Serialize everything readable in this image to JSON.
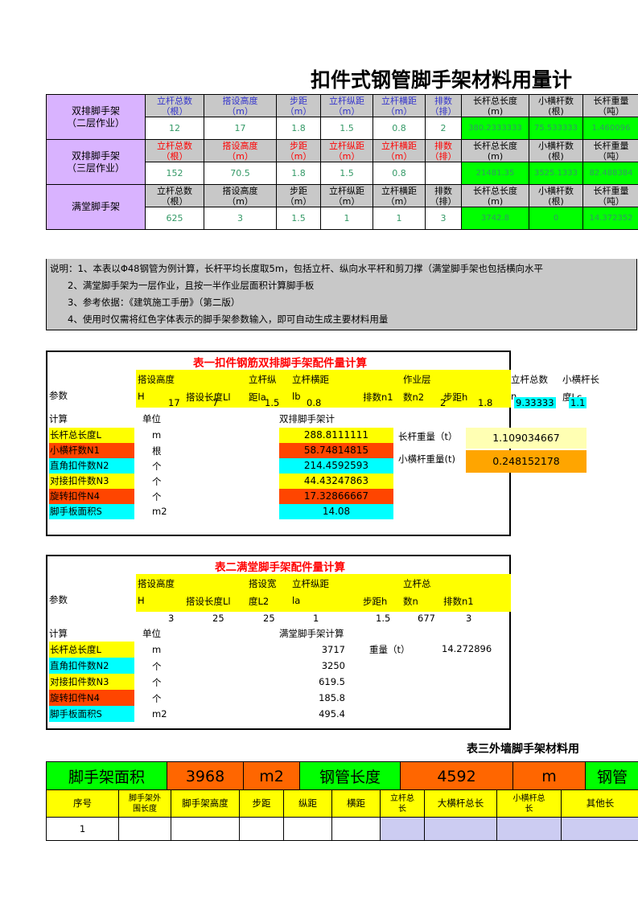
{
  "document": {
    "title": "扣件式钢管脚手架材料用量计"
  },
  "table_a": {
    "columns": [
      "立杆总数（根）",
      "搭设高度（m）",
      "步距（m）",
      "立杆纵距（m）",
      "立杆横距（m）",
      "排数（排）",
      "长杆总长度（m）",
      "小横杆数（根）",
      "长杆重量（吨）"
    ],
    "col_lines": [
      {
        "l1": "立杆总数",
        "l2": "（根）"
      },
      {
        "l1": "搭设高度",
        "l2": "（m）"
      },
      {
        "l1": "步距",
        "l2": "（m）"
      },
      {
        "l1": "立杆纵距",
        "l2": "（m）"
      },
      {
        "l1": "立杆横距",
        "l2": "（m）"
      },
      {
        "l1": "排数",
        "l2": "（排）"
      },
      {
        "l1": "长杆总长度",
        "l2": "(m)"
      },
      {
        "l1": "小横杆数",
        "l2": "(根)"
      },
      {
        "l1": "长杆重量",
        "l2": "（吨）"
      }
    ],
    "rows": [
      {
        "label_l1": "双排脚手架",
        "label_l2": "（二层作业）",
        "header_color": "#3333cc",
        "values": [
          "12",
          "17",
          "1.8",
          "1.5",
          "0.8",
          "2",
          "380.2333333",
          "75.533333",
          "1.460096"
        ]
      },
      {
        "label_l1": "双排脚手架",
        "label_l2": "（三层作业）",
        "header_color": "#ff0000",
        "values": [
          "152",
          "70.5",
          "1.8",
          "1.5",
          "0.8",
          "",
          "21481.35",
          "3525.1333",
          "82.488384"
        ]
      },
      {
        "label_l1": "满堂脚手架",
        "label_l2": "",
        "header_color": "#000000",
        "values": [
          "625",
          "3",
          "1.5",
          "1",
          "1",
          "3",
          "3742.8",
          "0",
          "14.372352"
        ]
      }
    ]
  },
  "notes": {
    "line1": "说明：1、本表以Φ48钢管为例计算，长杆平均长度取5m，包括立杆、纵向水平杆和剪刀撑（满堂脚手架也包括横向水平",
    "line2": "2、满堂脚手架为一层作业，且按一半作业层面积计算脚手板",
    "line3": "3、参考依据：《建筑施工手册》（第二版）",
    "line4": "4、使用时仅需将红色字体表示的脚手架参数输入，即可自动生成主要材料用量"
  },
  "table1": {
    "title": "表一扣件钢筋双排脚手架配件量计算",
    "param_label": "参数",
    "headers": [
      {
        "l1": "搭设高度",
        "l2": "H"
      },
      {
        "l1": "",
        "l2": "搭设长度Ll"
      },
      {
        "l1": "立杆纵",
        "l2": "距la"
      },
      {
        "l1": "立杆横距",
        "l2": "lb"
      },
      {
        "l1": "",
        "l2": "排数n1"
      },
      {
        "l1": "作业层",
        "l2": "数n2"
      },
      {
        "l1": "",
        "l2": "步距h"
      },
      {
        "l1": "立杆总数",
        "l2": "n"
      },
      {
        "l1": "小横杆长",
        "l2": "度Lc"
      }
    ],
    "param_values": [
      "17",
      "7",
      "1.5",
      "0.8",
      "",
      "2",
      "1.8",
      "9.33333",
      "1.1"
    ],
    "calc_label": "计算",
    "unit_label": "单位",
    "result_label": "双排脚手架计",
    "rows": [
      {
        "label": "长杆总长度L",
        "unit": "m",
        "value": "288.8111111",
        "label_bg": "#ffff00",
        "value_bg": "#ffff00"
      },
      {
        "label": "小横杆数N1",
        "unit": "根",
        "value": "58.74814815",
        "label_bg": "#ff4500",
        "value_bg": "#ff4500"
      },
      {
        "label": "直角扣件数N2",
        "unit": "个",
        "value": "214.4592593",
        "label_bg": "#00ffff",
        "value_bg": "#00ffff"
      },
      {
        "label": "对接扣件数N3",
        "unit": "个",
        "value": "44.43247863",
        "label_bg": "#ffff00",
        "value_bg": "#ffff00"
      },
      {
        "label": "旋转扣件N4",
        "unit": "个",
        "value": "17.32866667",
        "label_bg": "#ff4500",
        "value_bg": "#ff4500"
      },
      {
        "label": "脚手板面积S",
        "unit": "m2",
        "value": "14.08",
        "label_bg": "#00ffff",
        "value_bg": "#00ffff"
      }
    ],
    "weights": [
      {
        "label": "长杆重量（t）",
        "value": "1.109034667",
        "bg": "#ffffb3"
      },
      {
        "label": "小横杆重量(t)",
        "value": "0.248152178",
        "bg": "#ffa500"
      }
    ]
  },
  "table2": {
    "title": "表二满堂脚手架配件量计算",
    "param_label": "参数",
    "headers": [
      {
        "l1": "搭设高度",
        "l2": "H"
      },
      {
        "l1": "",
        "l2": "搭设长度Ll"
      },
      {
        "l1": "搭设宽",
        "l2": "度L2"
      },
      {
        "l1": "立杆纵距",
        "l2": "la"
      },
      {
        "l1": "",
        "l2": "步距h"
      },
      {
        "l1": "立杆总",
        "l2": "数n"
      },
      {
        "l1": "",
        "l2": "排数n1"
      }
    ],
    "param_values": [
      "3",
      "25",
      "25",
      "1",
      "1.5",
      "677",
      "3"
    ],
    "calc_label": "计算",
    "unit_label": "单位",
    "result_label": "满堂脚手架计算",
    "rows": [
      {
        "label": "长杆总长度L",
        "unit": "m",
        "value": "3717",
        "label_bg": "#ffff00"
      },
      {
        "label": "直角扣件数N2",
        "unit": "个",
        "value": "3250",
        "label_bg": "#00ffff"
      },
      {
        "label": "对接扣件数N3",
        "unit": "个",
        "value": "619.5",
        "label_bg": "#ffff00"
      },
      {
        "label": "旋转扣件N4",
        "unit": "个",
        "value": "185.8",
        "label_bg": "#ff4500"
      },
      {
        "label": "脚手板面积S",
        "unit": "m2",
        "value": "495.4",
        "label_bg": "#00ffff"
      }
    ],
    "weight_label": "重量（t）",
    "weight_value": "14.272896"
  },
  "table3": {
    "caption": "表三外墙脚手架材料用",
    "banner": [
      {
        "text": "脚手架面积",
        "kind": "label"
      },
      {
        "text": "3968",
        "kind": "value"
      },
      {
        "text": "m2",
        "kind": "unit"
      },
      {
        "text": "钢管长度",
        "kind": "label"
      },
      {
        "text": "4592",
        "kind": "value"
      },
      {
        "text": "m",
        "kind": "unit"
      },
      {
        "text": "钢管",
        "kind": "label"
      }
    ],
    "columns": [
      {
        "l1": "序号",
        "l2": ""
      },
      {
        "l1": "脚手架外",
        "l2": "围长度"
      },
      {
        "l1": "脚手架高度",
        "l2": ""
      },
      {
        "l1": "步距",
        "l2": ""
      },
      {
        "l1": "纵距",
        "l2": ""
      },
      {
        "l1": "横距",
        "l2": ""
      },
      {
        "l1": "立杆总",
        "l2": "长"
      },
      {
        "l1": "大横杆总长",
        "l2": ""
      },
      {
        "l1": "小横杆总",
        "l2": "长"
      },
      {
        "l1": "其他长",
        "l2": ""
      }
    ],
    "row": [
      "1",
      "",
      "",
      "",
      "",
      "",
      "",
      "",
      "",
      ""
    ]
  }
}
